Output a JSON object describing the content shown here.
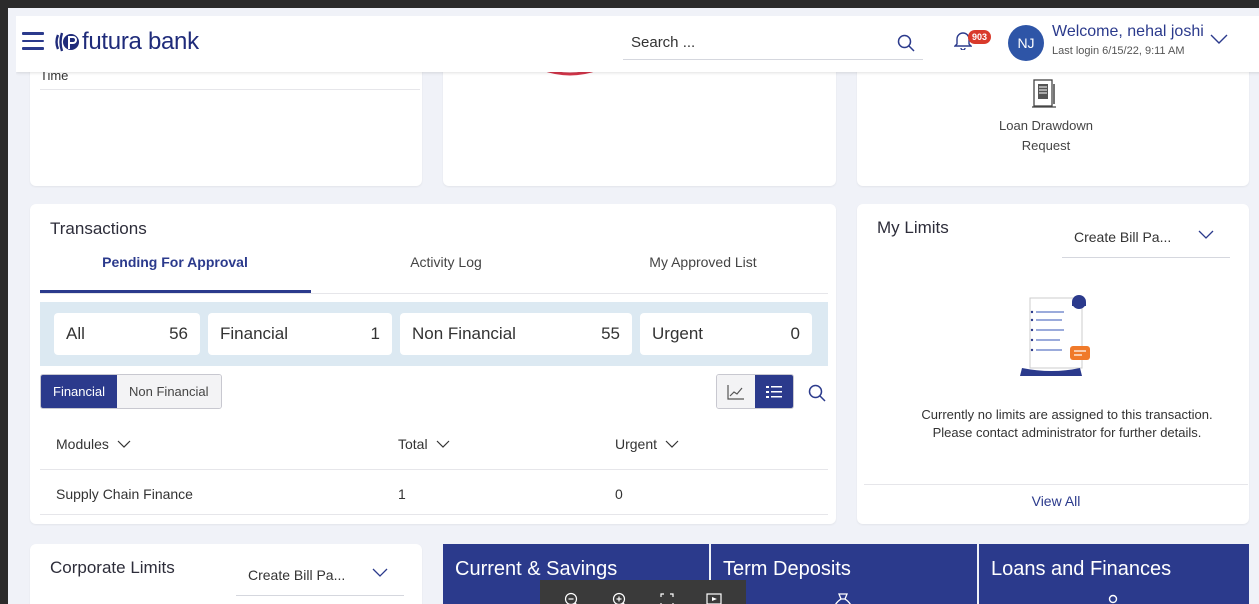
{
  "header": {
    "brand": "futura bank",
    "search_placeholder": "Search ...",
    "notification_count": "903",
    "avatar_initials": "NJ",
    "welcome": "Welcome, nehal joshi",
    "last_login": "Last login 6/15/22, 9:11 AM"
  },
  "top_cards": {
    "time_label": "Time",
    "loan_label": "Loan Drawdown Request"
  },
  "transactions": {
    "title": "Transactions",
    "tabs": [
      "Pending For Approval",
      "Activity Log",
      "My Approved List"
    ],
    "summary": [
      {
        "label": "All",
        "count": "56"
      },
      {
        "label": "Financial",
        "count": "1"
      },
      {
        "label": "Non Financial",
        "count": "55"
      },
      {
        "label": "Urgent",
        "count": "0"
      }
    ],
    "filter": {
      "financial": "Financial",
      "non_financial": "Non Financial"
    },
    "columns": {
      "modules": "Modules",
      "total": "Total",
      "urgent": "Urgent"
    },
    "rows": [
      {
        "module": "Supply Chain Finance",
        "total": "1",
        "urgent": "0"
      }
    ]
  },
  "my_limits": {
    "title": "My Limits",
    "dropdown_value": "Create Bill Pa...",
    "message_line1": "Currently no limits are assigned to this transaction.",
    "message_line2": "Please contact administrator for further details.",
    "view_all": "View All"
  },
  "corporate_limits": {
    "title": "Corporate Limits",
    "dropdown_value": "Create Bill Pa..."
  },
  "tiles": [
    "Current & Savings",
    "Term Deposits",
    "Loans and Finances"
  ],
  "colors": {
    "primary": "#2b3a8c",
    "badge": "#d93a2b",
    "summary_bg": "#dce9f2",
    "accent_orange": "#f07a2a"
  }
}
